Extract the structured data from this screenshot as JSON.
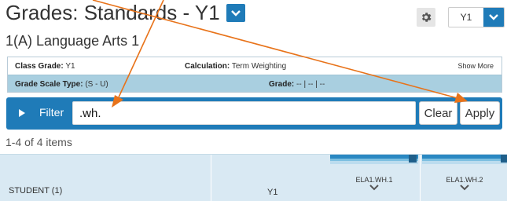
{
  "header": {
    "title": "Grades: Standards - Y1",
    "subtitle": "1(A) Language Arts 1",
    "term_value": "Y1"
  },
  "info": {
    "class_grade_label": "Class Grade:",
    "class_grade_value": "Y1",
    "calculation_label": "Calculation:",
    "calculation_value": "Term Weighting",
    "show_more": "Show More",
    "grade_scale_label": "Grade Scale Type:",
    "grade_scale_value": "(S - U)",
    "grade_label": "Grade:",
    "grade_value": "-- | -- | --"
  },
  "filter": {
    "label": "Filter",
    "value": ".wh.",
    "clear_label": "Clear",
    "apply_label": "Apply"
  },
  "count_text": "1-4 of 4 items",
  "grid": {
    "student_header": "STUDENT (1)",
    "term_header": "Y1",
    "standards": [
      {
        "label": "ELA1.WH.1"
      },
      {
        "label": "ELA1.WH.2"
      }
    ]
  },
  "colors": {
    "accent": "#1f7bb8",
    "arrow": "#e8731a"
  }
}
